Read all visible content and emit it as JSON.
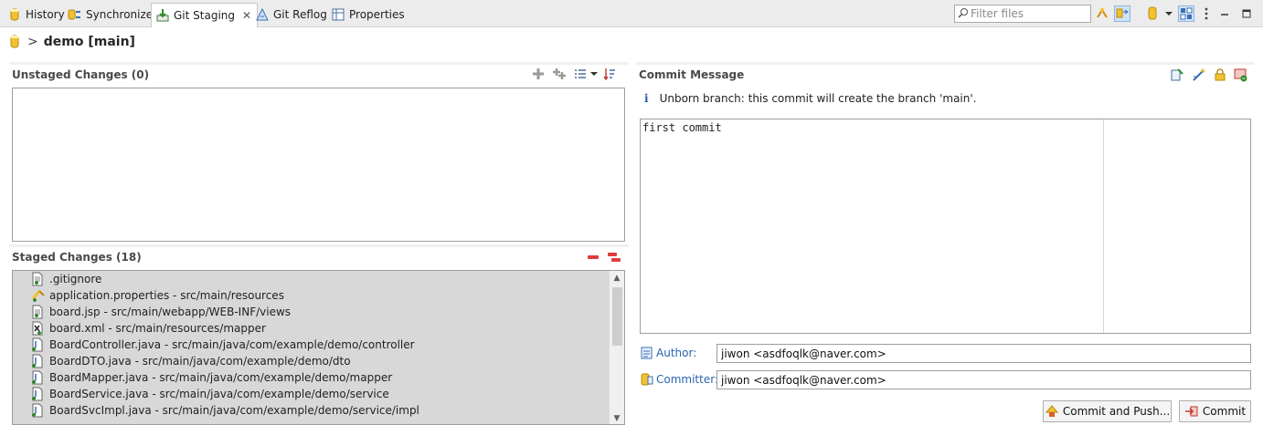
{
  "tabs": [
    {
      "label": "History",
      "icon": "history-icon"
    },
    {
      "label": "Synchronize",
      "icon": "synchronize-icon"
    },
    {
      "label": "Git Staging",
      "icon": "git-staging-icon",
      "active": true
    },
    {
      "label": "Git Reflog",
      "icon": "git-reflog-icon"
    },
    {
      "label": "Properties",
      "icon": "properties-icon"
    }
  ],
  "filter": {
    "placeholder": "Filter files",
    "value": ""
  },
  "repo": {
    "name": "demo [main]",
    "separator": ">"
  },
  "unstaged": {
    "title": "Unstaged Changes (0)"
  },
  "staged": {
    "title": "Staged Changes (18)",
    "files": [
      {
        "label": ".gitignore",
        "icon": "text-file-added-icon"
      },
      {
        "label": "application.properties - src/main/resources",
        "icon": "properties-file-added-icon"
      },
      {
        "label": "board.jsp - src/main/webapp/WEB-INF/views",
        "icon": "text-file-added-icon"
      },
      {
        "label": "board.xml - src/main/resources/mapper",
        "icon": "xml-file-added-icon"
      },
      {
        "label": "BoardController.java - src/main/java/com/example/demo/controller",
        "icon": "java-file-added-icon"
      },
      {
        "label": "BoardDTO.java - src/main/java/com/example/demo/dto",
        "icon": "java-file-added-icon"
      },
      {
        "label": "BoardMapper.java - src/main/java/com/example/demo/mapper",
        "icon": "java-file-added-icon"
      },
      {
        "label": "BoardService.java - src/main/java/com/example/demo/service",
        "icon": "java-file-added-icon"
      },
      {
        "label": "BoardSvcImpl.java - src/main/java/com/example/demo/service/impl",
        "icon": "java-file-added-icon"
      }
    ]
  },
  "commit": {
    "title": "Commit Message",
    "info": "Unborn branch: this commit will create the branch 'main'.",
    "message": "first commit",
    "author_label": "Author:",
    "author_value": "jiwon <asdfoqlk@naver.com>",
    "committer_label": "Committer:",
    "committer_value": "jiwon <asdfoqlk@naver.com>",
    "commit_and_push_label": "Commit and Push...",
    "commit_label": "Commit"
  },
  "colors": {
    "accent_blue": "#2a63b0",
    "remove_red": "#e03c3c",
    "selection_gray": "#d8d8d8"
  }
}
